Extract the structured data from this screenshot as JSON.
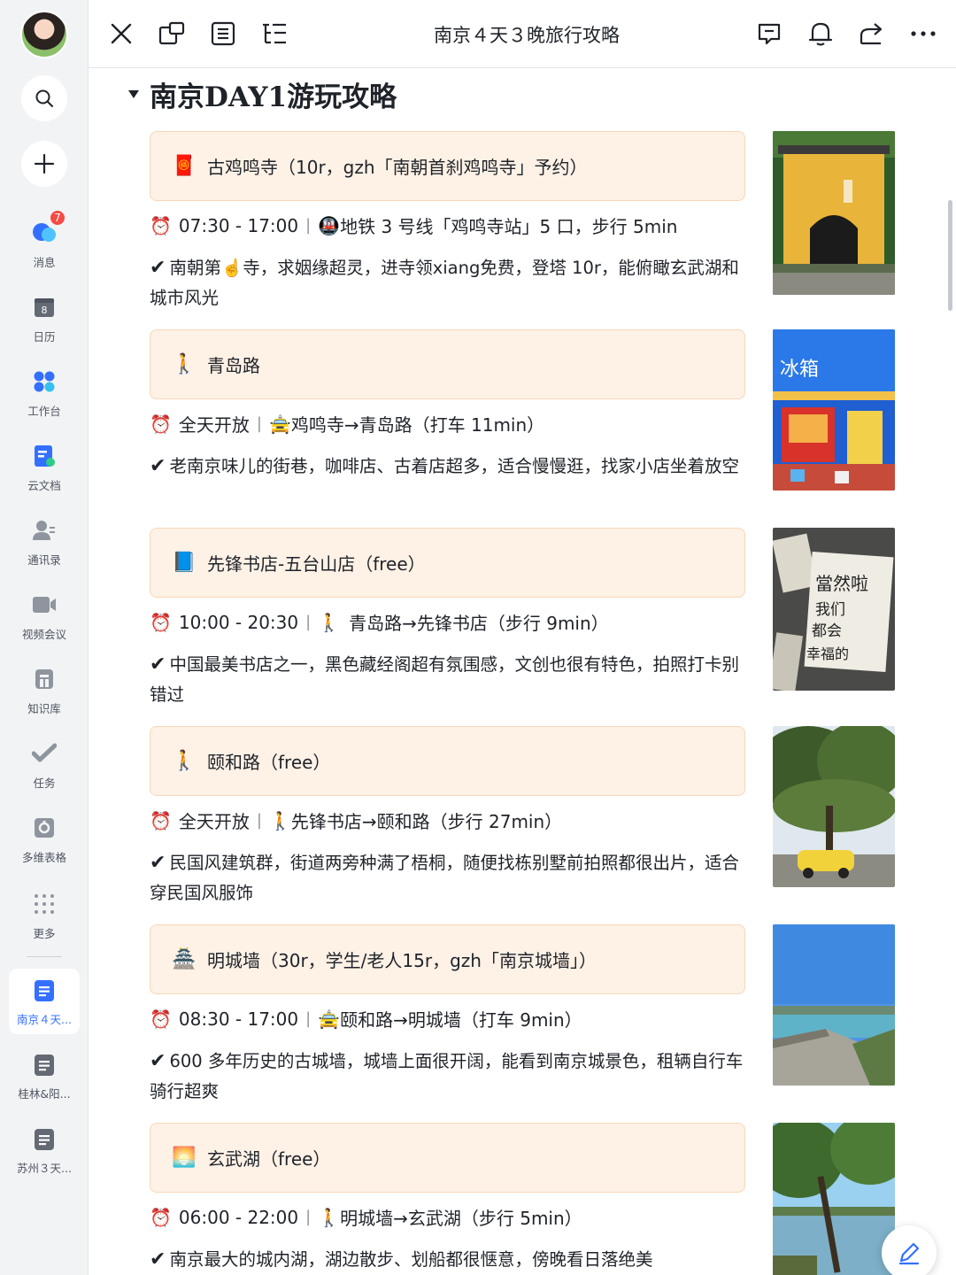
{
  "sidebar": {
    "messages_badge": "7",
    "items": [
      {
        "label": "消息"
      },
      {
        "label": "日历",
        "icon_text": "8"
      },
      {
        "label": "工作台"
      },
      {
        "label": "云文档"
      },
      {
        "label": "通讯录"
      },
      {
        "label": "视频会议"
      },
      {
        "label": "知识库"
      },
      {
        "label": "任务"
      },
      {
        "label": "多维表格"
      },
      {
        "label": "更多"
      }
    ],
    "recent_docs": [
      {
        "label": "南京４天...",
        "active": true
      },
      {
        "label": "桂林&阳..."
      },
      {
        "label": "苏州３天..."
      }
    ]
  },
  "topbar": {
    "title": "南京４天３晚旅行攻略"
  },
  "doc": {
    "heading": "南京DAY1游玩攻略",
    "entries": [
      {
        "icon": "🧧",
        "name": "古鸡鸣寺（10r，gzh「南朝首刹鸡鸣寺」予约）",
        "hours": "07:30 - 17:00",
        "transport_icon": "🚇",
        "transport": "地铁 3 号线「鸡鸣寺站」5 口，步行 5min",
        "desc": "南朝第☝️寺，求姻缘超灵，进寺领xiang免费，登塔 10r，能俯瞰玄武湖和城市风光"
      },
      {
        "icon": "🚶",
        "name": "青岛路",
        "hours": "全天开放",
        "transport_icon": "🚖",
        "transport": "鸡鸣寺→青岛路（打车 11min）",
        "desc": "老南京味儿的街巷，咖啡店、古着店超多，适合慢慢逛，找家小店坐着放空"
      },
      {
        "icon": "📘",
        "name": "先锋书店-五台山店（free）",
        "hours": "10:00 - 20:30",
        "transport_icon": "🚶",
        "transport": "青岛路→先锋书店（步行 9min）",
        "desc": "中国最美书店之一，黑色藏经阁超有氛围感，文创也很有特色，拍照打卡别错过"
      },
      {
        "icon": "🚶",
        "name": "颐和路（free）",
        "hours": "全天开放",
        "transport_icon": "🚶",
        "transport": "先锋书店→颐和路（步行 27min）",
        "desc": "民国风建筑群，街道两旁种满了梧桐，随便找栋别墅前拍照都很出片，适合穿民国风服饰"
      },
      {
        "icon": "🏯",
        "name": "明城墙（30r，学生/老人15r，gzh「南京城墙」）",
        "hours": "08:30 - 17:00",
        "transport_icon": "🚖",
        "transport": "颐和路→明城墙（打车 9min）",
        "desc": "600 多年历史的古城墙，城墙上面很开阔，能看到南京城景色，租辆自行车骑行超爽"
      },
      {
        "icon": "🌅",
        "name": "玄武湖（free）",
        "hours": "06:00 - 22:00",
        "transport_icon": "🚶",
        "transport": "明城墙→玄武湖（步行 5min）",
        "desc": "南京最大的城内湖，湖边散步、划船都很惬意，傍晚看日落绝美"
      }
    ],
    "clock_icon": "⏰",
    "check_icon": "✔"
  }
}
